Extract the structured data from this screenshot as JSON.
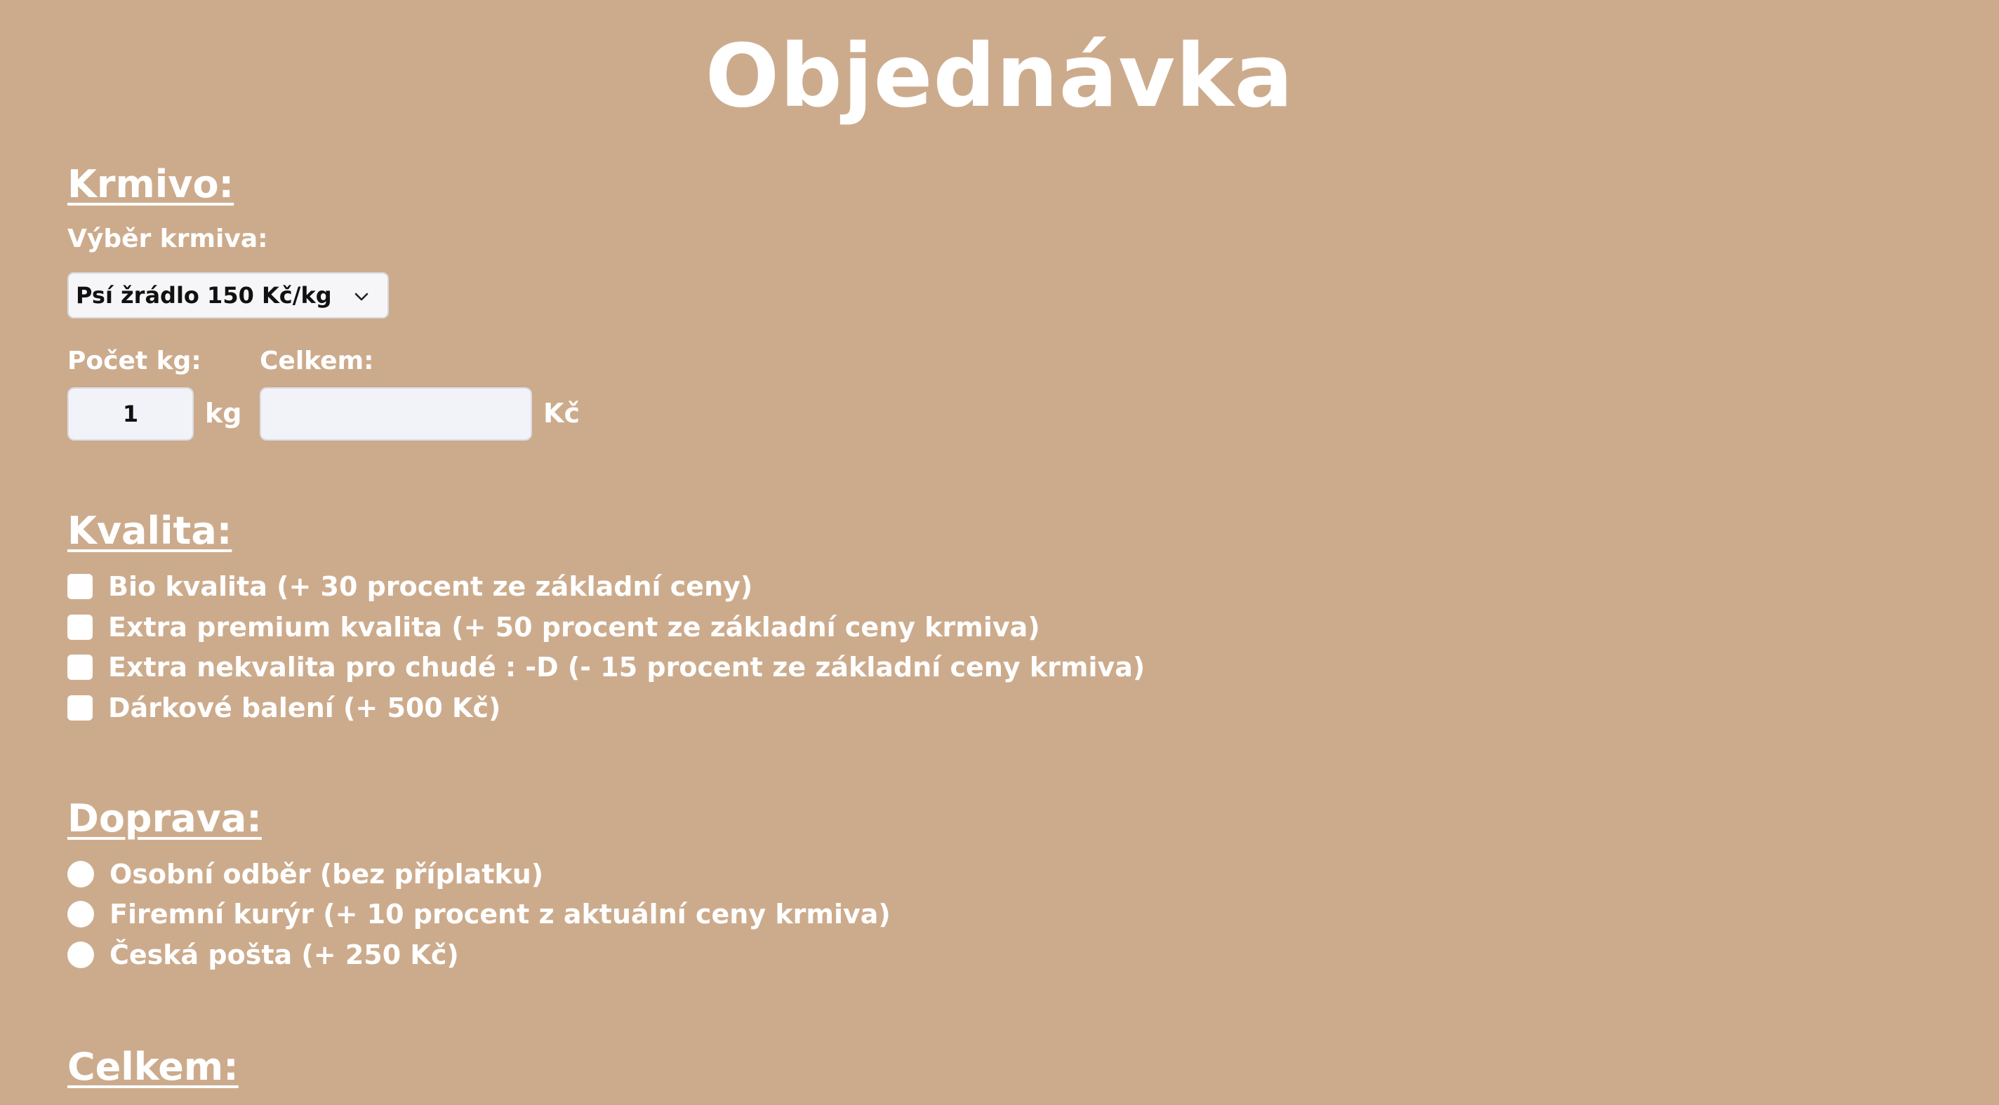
{
  "page": {
    "title": "Objednávka"
  },
  "krmivo": {
    "heading": "Krmivo:",
    "select_label": "Výběr krmiva:",
    "select_value": "Psí žrádlo 150 Kč/kg",
    "kg_label": "Počet kg:",
    "kg_value": "1",
    "kg_unit": "kg",
    "total_label": "Celkem:",
    "total_value": "",
    "total_unit": "Kč"
  },
  "kvalita": {
    "heading": "Kvalita:",
    "options": [
      {
        "label": "Bio kvalita (+ 30 procent ze základní ceny)",
        "checked": false
      },
      {
        "label": "Extra premium kvalita (+ 50 procent ze základní ceny krmiva)",
        "checked": false
      },
      {
        "label": "Extra nekvalita pro chudé : -D (- 15 procent ze základní ceny krmiva)",
        "checked": false
      },
      {
        "label": "Dárkové balení (+ 500 Kč)",
        "checked": false
      }
    ]
  },
  "doprava": {
    "heading": "Doprava:",
    "options": [
      {
        "label": "Osobní odběr (bez příplatku)",
        "selected": false
      },
      {
        "label": "Firemní kurýr (+ 10 procent z aktuální ceny krmiva)",
        "selected": false
      },
      {
        "label": "Česká pošta (+ 250 Kč)",
        "selected": false
      }
    ]
  },
  "celkem": {
    "heading": "Celkem:"
  },
  "colors": {
    "background": "#ccab8c",
    "text": "#ffffff",
    "input_background": "#f1f3f8"
  },
  "icons": {
    "select_arrow": "chevron-down-icon"
  }
}
